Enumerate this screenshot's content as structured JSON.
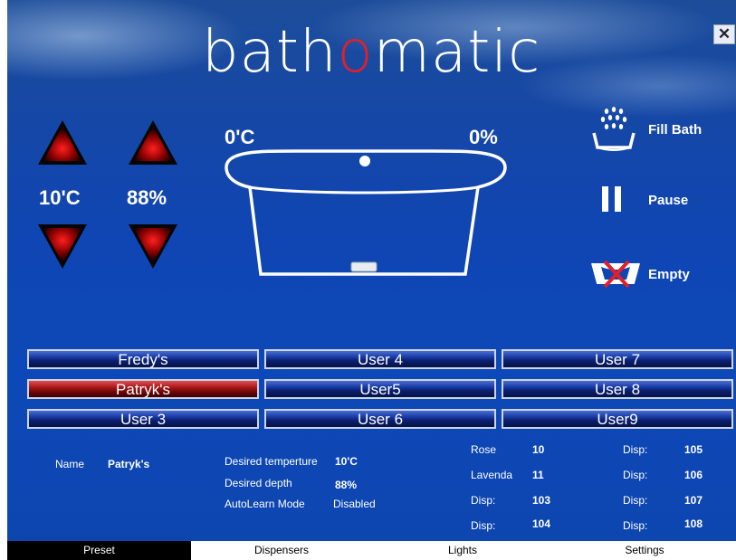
{
  "app": {
    "logo_left": "bath",
    "logo_o": "o",
    "logo_right": "matic",
    "close_glyph": "✕"
  },
  "controls": {
    "set_temperature": "10'C",
    "set_depth": "88%",
    "current_temperature": "0'C",
    "current_fill": "0%"
  },
  "actions": {
    "fill_label": "Fill Bath",
    "pause_label": "Pause",
    "empty_label": "Empty"
  },
  "users": {
    "row1": [
      "Fredy's",
      "User 4",
      "User 7"
    ],
    "row2": [
      "Patryk's",
      "User5",
      "User 8"
    ],
    "row3": [
      "User 3",
      "User 6",
      "User9"
    ],
    "selected": "Patryk's"
  },
  "info": {
    "name_label": "Name",
    "name_value": "Patryk's",
    "temp_label": "Desired temperture",
    "temp_value": "10'C",
    "depth_label": "Desired depth",
    "depth_value": "88%",
    "autolearn_label": "AutoLearn Mode",
    "autolearn_value": "Disabled"
  },
  "dispensers_col1": [
    {
      "label": "Rose",
      "value": "10"
    },
    {
      "label": "Lavenda",
      "value": "11"
    },
    {
      "label": "Disp:",
      "value": "103"
    },
    {
      "label": "Disp:",
      "value": "104"
    }
  ],
  "dispensers_col2": [
    {
      "label": "Disp:",
      "value": "105"
    },
    {
      "label": "Disp:",
      "value": "106"
    },
    {
      "label": "Disp:",
      "value": "107"
    },
    {
      "label": "Disp:",
      "value": "108"
    }
  ],
  "tabs": [
    "Preset",
    "Dispensers",
    "Lights",
    "Settings"
  ],
  "active_tab": "Preset",
  "colors": {
    "accent_red": "#e0202a",
    "panel_blue": "#0f46b4"
  },
  "icons": [
    "close-icon",
    "up-arrow-icon",
    "down-arrow-icon",
    "bathtub-icon",
    "shower-icon",
    "pause-icon",
    "empty-bath-icon"
  ]
}
